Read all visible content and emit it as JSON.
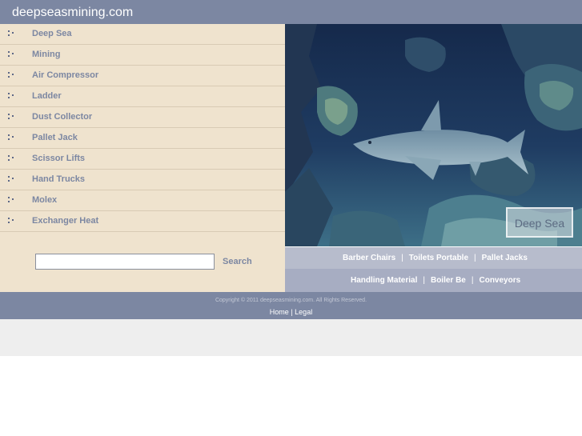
{
  "site": {
    "title": "deepseasmining.com"
  },
  "nav": {
    "items": [
      {
        "label": "Deep Sea"
      },
      {
        "label": "Mining"
      },
      {
        "label": "Air Compressor"
      },
      {
        "label": "Ladder"
      },
      {
        "label": "Dust Collector"
      },
      {
        "label": "Pallet Jack"
      },
      {
        "label": "Scissor Lifts"
      },
      {
        "label": "Hand Trucks"
      },
      {
        "label": "Molex"
      },
      {
        "label": "Exchanger Heat"
      }
    ]
  },
  "search": {
    "value": "",
    "button_label": "Search"
  },
  "photo": {
    "caption": "Deep Sea"
  },
  "links": {
    "row1": [
      "Barber Chairs",
      "Toilets Portable",
      "Pallet Jacks"
    ],
    "row2": [
      "Handling Material",
      "Boiler Be",
      "Conveyors"
    ],
    "separator": "|"
  },
  "footer": {
    "copyright": "Copyright © 2011 deepseasmining.com. All Rights Reserved.",
    "home": "Home",
    "separator": "|",
    "legal": "Legal"
  },
  "colors": {
    "header": "#7c87a2",
    "sidebar": "#efe3ce",
    "nav_text": "#7c87a2",
    "link_bar_1": "#b7bccc",
    "link_bar_2": "#a7adc2",
    "ocean": "#1d3558"
  }
}
